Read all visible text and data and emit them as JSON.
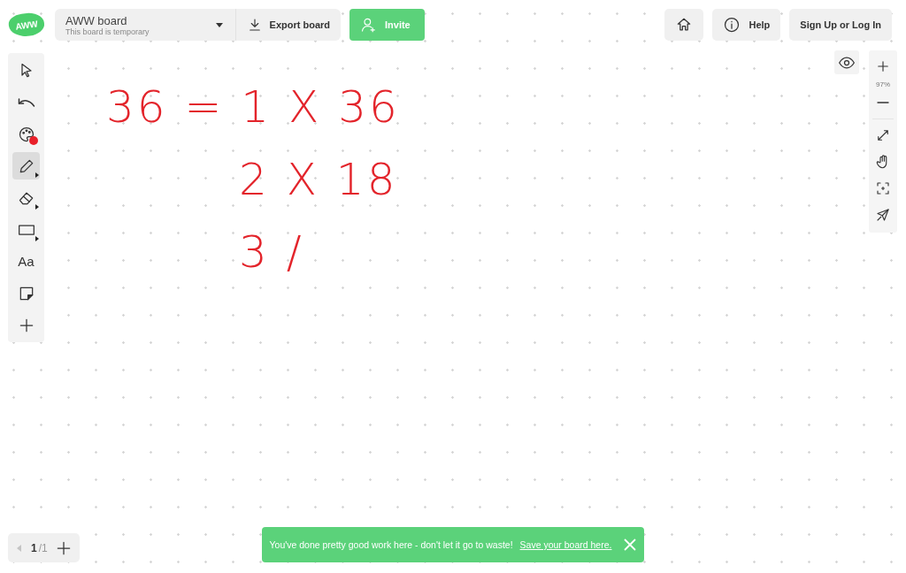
{
  "logo": {
    "text": "AWW"
  },
  "board": {
    "title": "AWW board",
    "subtitle": "This board is temporary"
  },
  "toolbar_buttons": [
    {
      "kind": "export",
      "label": "Export board"
    },
    {
      "kind": "invite",
      "label": "Invite"
    }
  ],
  "header_right": [
    {
      "kind": "home"
    },
    {
      "kind": "help",
      "label": "Help"
    },
    {
      "kind": "text",
      "label": "Sign Up or Log In"
    }
  ],
  "tools": [
    {
      "kind": "select",
      "selected": false
    },
    {
      "kind": "undo",
      "selected": false
    },
    {
      "kind": "palette",
      "selected": false,
      "color": "#e8202a"
    },
    {
      "kind": "pencil",
      "selected": true,
      "submenu": true
    },
    {
      "kind": "eraser",
      "selected": false,
      "submenu": true
    },
    {
      "kind": "rectangle",
      "selected": false,
      "submenu": true
    },
    {
      "kind": "text",
      "label": "Aa",
      "selected": false
    },
    {
      "kind": "note",
      "selected": false
    },
    {
      "kind": "add",
      "selected": false
    }
  ],
  "zoom": {
    "level_text": "97%"
  },
  "ink": {
    "color": "#e3242b",
    "lines": [
      "36 = 1 X 36",
      "2 X 18",
      "3 /"
    ]
  },
  "pages": {
    "current": "1",
    "total": "/1",
    "prev_disabled": true
  },
  "toast": {
    "message": "You've done pretty good work here - don't let it go to waste!",
    "link": "Save your board here."
  }
}
